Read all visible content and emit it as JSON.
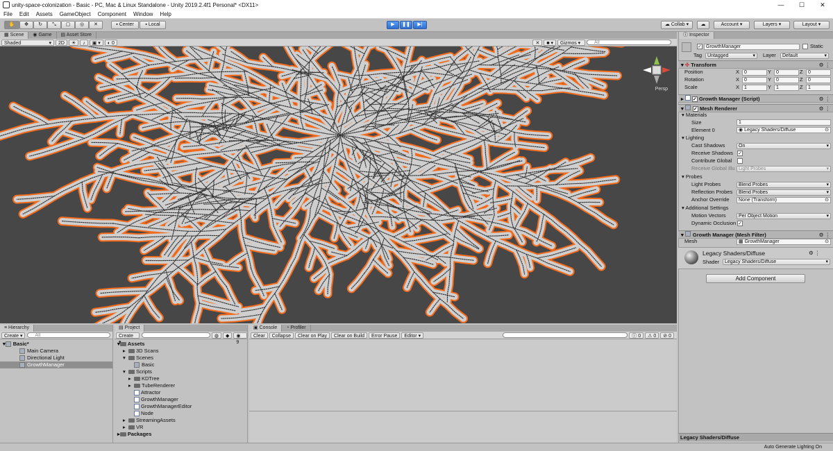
{
  "window": {
    "title": "unity-space-colonization - Basic - PC, Mac & Linux Standalone - Unity 2019.2.4f1 Personal* <DX11>"
  },
  "menu": [
    "File",
    "Edit",
    "Assets",
    "GameObject",
    "Component",
    "Window",
    "Help"
  ],
  "toolbar": {
    "pivot_center": "Center",
    "pivot_local": "Local",
    "collab": "Collab",
    "account": "Account",
    "layers": "Layers",
    "layout": "Layout"
  },
  "scene": {
    "tabs": [
      "Scene",
      "Game",
      "Asset Store"
    ],
    "shading": "Shaded",
    "mode_2d": "2D",
    "fx_count": "0",
    "gizmos": "Gizmos",
    "search_placeholder": "All",
    "persp": "Persp"
  },
  "hierarchy": {
    "tab": "Hierarchy",
    "create": "Create",
    "search_placeholder": "All",
    "scene_name": "Basic*",
    "items": [
      "Main Camera",
      "Directional Light",
      "GrowthManager"
    ]
  },
  "project": {
    "tab": "Project",
    "create": "Create",
    "badge_count": "9",
    "root": "Assets",
    "items": [
      {
        "label": "3D Scans",
        "level": 1,
        "type": "folder"
      },
      {
        "label": "Scenes",
        "level": 1,
        "type": "folder"
      },
      {
        "label": "Basic",
        "level": 2,
        "type": "scene"
      },
      {
        "label": "Scripts",
        "level": 1,
        "type": "folder"
      },
      {
        "label": "KDTree",
        "level": 2,
        "type": "folder"
      },
      {
        "label": "TubeRenderer",
        "level": 2,
        "type": "folder"
      },
      {
        "label": "Attractor",
        "level": 2,
        "type": "script"
      },
      {
        "label": "GrowthManager",
        "level": 2,
        "type": "script"
      },
      {
        "label": "GrowthManagerEditor",
        "level": 2,
        "type": "script"
      },
      {
        "label": "Node",
        "level": 2,
        "type": "script"
      },
      {
        "label": "StreamingAssets",
        "level": 1,
        "type": "folder"
      },
      {
        "label": "VR",
        "level": 1,
        "type": "folder"
      }
    ],
    "packages": "Packages"
  },
  "console": {
    "tabs": [
      "Console",
      "Profiler"
    ],
    "buttons": [
      "Clear",
      "Collapse",
      "Clear on Play",
      "Clear on Build",
      "Error Pause",
      "Editor"
    ],
    "counts": [
      "0",
      "0",
      "0"
    ]
  },
  "inspector": {
    "tab": "Inspector",
    "object_name": "GrowthManager",
    "static_label": "Static",
    "tag_label": "Tag",
    "tag_value": "Untagged",
    "layer_label": "Layer",
    "layer_value": "Default",
    "transform": {
      "title": "Transform",
      "position_label": "Position",
      "rotation_label": "Rotation",
      "scale_label": "Scale",
      "position": [
        "0",
        "0",
        "0"
      ],
      "rotation": [
        "0",
        "0",
        "0"
      ],
      "scale": [
        "1",
        "1",
        "1"
      ],
      "axes": [
        "X",
        "Y",
        "Z"
      ]
    },
    "script_title": "Growth Manager (Script)",
    "mesh_renderer": {
      "title": "Mesh Renderer",
      "materials": "Materials",
      "size_label": "Size",
      "size_value": "1",
      "element0_label": "Element 0",
      "element0_value": "Legacy Shaders/Diffuse",
      "lighting": "Lighting",
      "cast_shadows_label": "Cast Shadows",
      "cast_shadows_value": "On",
      "receive_shadows_label": "Receive Shadows",
      "contribute_gi_label": "Contribute Global",
      "receive_gi_label": "Receive Global Illu",
      "receive_gi_value": "Light Probes",
      "probes": "Probes",
      "light_probes_label": "Light Probes",
      "light_probes_value": "Blend Probes",
      "reflection_probes_label": "Reflection Probes",
      "reflection_probes_value": "Blend Probes",
      "anchor_override_label": "Anchor Override",
      "anchor_override_value": "None (Transform)",
      "additional": "Additional Settings",
      "motion_vectors_label": "Motion Vectors",
      "motion_vectors_value": "Per Object Motion",
      "dynamic_occlusion_label": "Dynamic Occlusion"
    },
    "mesh_filter": {
      "title": "Growth Manager (Mesh Filter)",
      "mesh_label": "Mesh",
      "mesh_value": "GrowthManager"
    },
    "material": {
      "name": "Legacy Shaders/Diffuse",
      "shader_label": "Shader",
      "shader_value": "Legacy Shaders/Diffuse"
    },
    "add_component": "Add Component",
    "preview_title": "Legacy Shaders/Diffuse"
  },
  "status": {
    "auto_generate": "Auto Generate Lighting On"
  },
  "colors": {
    "accent": "#2f6fd1",
    "selection_outline": "#f26a1b",
    "tube": "#c9c9c9",
    "scene_bg": "#474747"
  }
}
